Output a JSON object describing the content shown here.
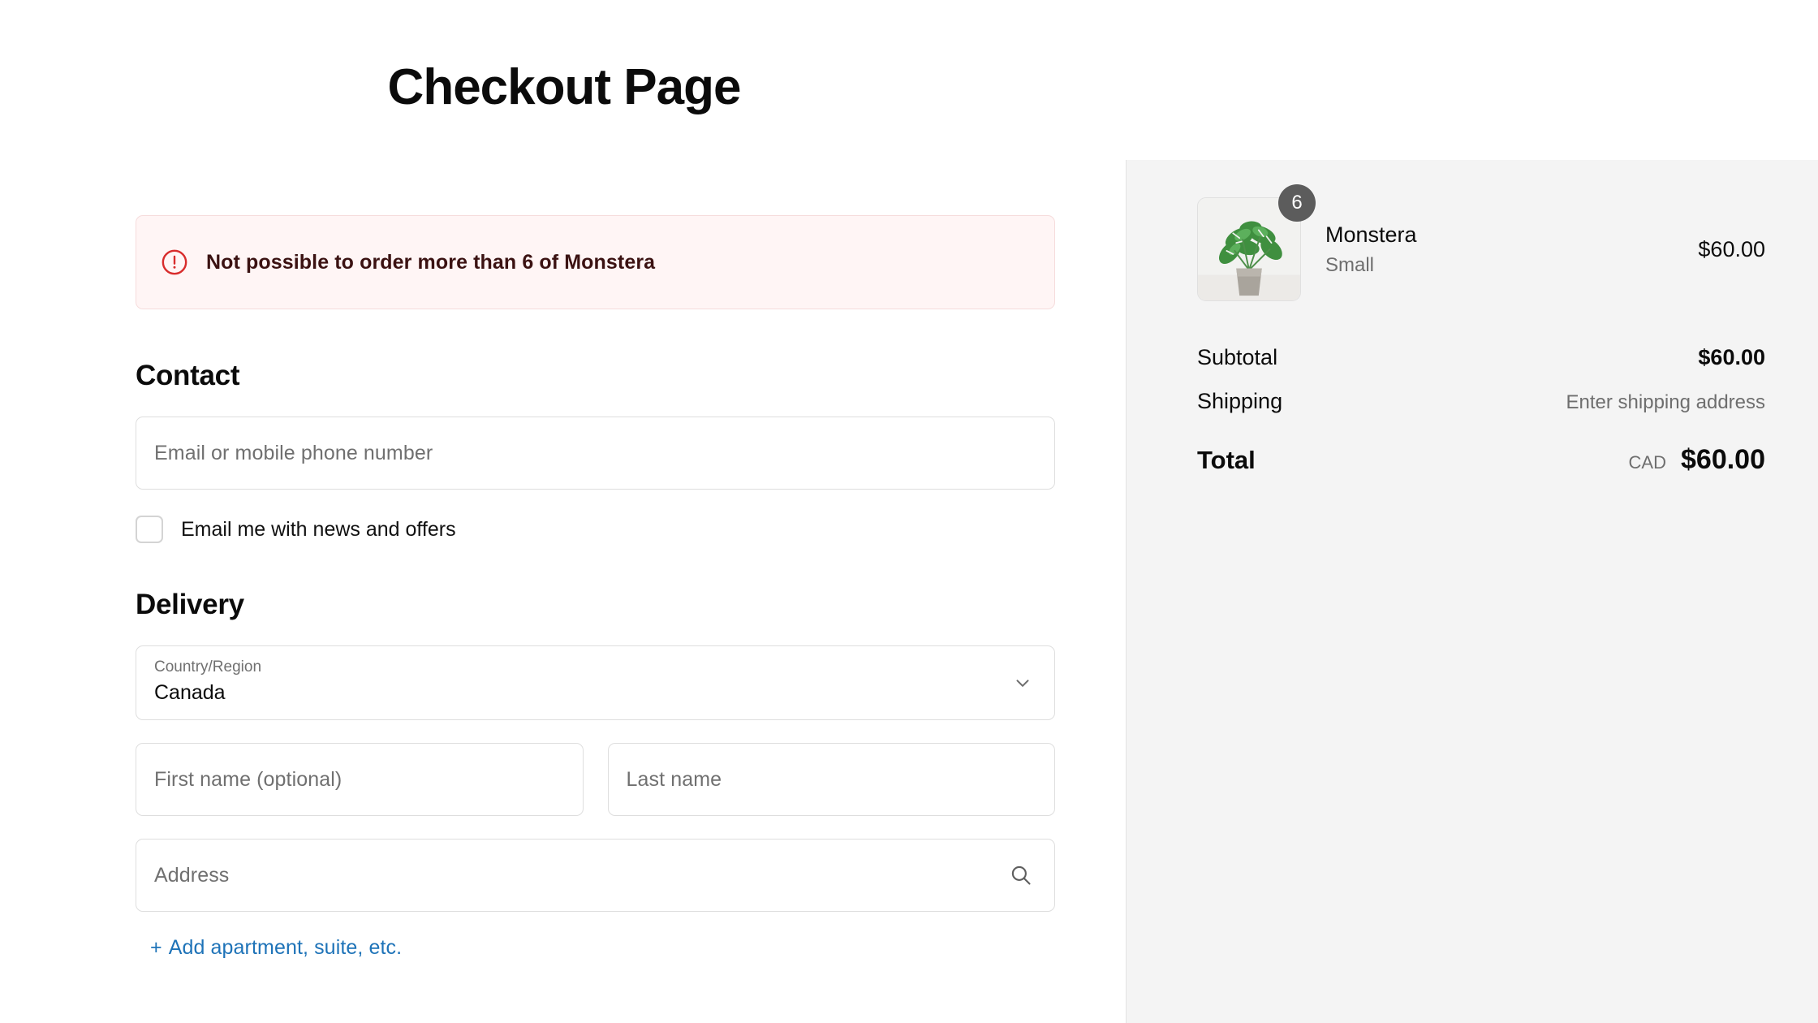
{
  "page": {
    "title": "Checkout Page"
  },
  "error": {
    "icon": "error-circle-icon",
    "message": "Not possible to order more than 6 of Monstera"
  },
  "contact": {
    "heading": "Contact",
    "email_placeholder": "Email or mobile phone number",
    "email_value": "",
    "newsletter_label": "Email me with news and offers",
    "newsletter_checked": false
  },
  "delivery": {
    "heading": "Delivery",
    "country": {
      "label": "Country/Region",
      "value": "Canada",
      "icon": "chevron-down-icon"
    },
    "first_name_placeholder": "First name (optional)",
    "first_name_value": "",
    "last_name_placeholder": "Last name",
    "last_name_value": "",
    "address_placeholder": "Address",
    "address_value": "",
    "address_icon": "search-icon",
    "add_apartment_plus": "+",
    "add_apartment_label": "Add apartment, suite, etc.",
    "link_color": "#1e73b8"
  },
  "summary": {
    "item": {
      "name": "Monstera",
      "variant": "Small",
      "quantity": "6",
      "price": "$60.00",
      "image": "monstera-plant-photo"
    },
    "totals": [
      {
        "label": "Subtotal",
        "value": "$60.00"
      },
      {
        "label": "Shipping",
        "value": "Enter shipping address"
      }
    ],
    "grand": {
      "label": "Total",
      "currency": "CAD",
      "amount": "$60.00"
    }
  }
}
